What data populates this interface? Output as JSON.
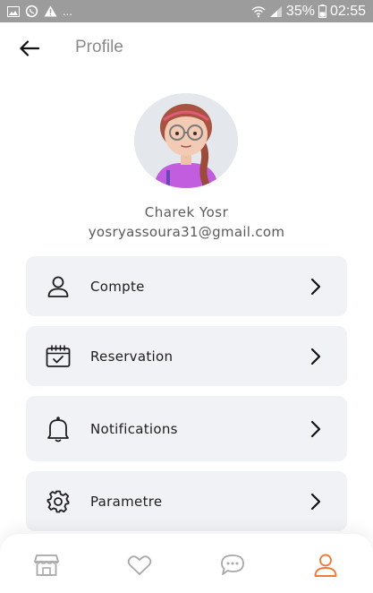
{
  "status_bar": {
    "more": "...",
    "battery": "35%",
    "time": "02:55"
  },
  "header": {
    "title": "Profile",
    "back_icon": "arrow-left-icon"
  },
  "user": {
    "name": "Charek Yosr",
    "email": "yosryassoura31@gmail.com"
  },
  "menu": [
    {
      "label": "Compte",
      "icon": "user-icon"
    },
    {
      "label": "Reservation",
      "icon": "calendar-check-icon"
    },
    {
      "label": "Notifications",
      "icon": "bell-icon"
    },
    {
      "label": "Parametre",
      "icon": "gear-icon"
    }
  ],
  "bottom_nav": {
    "items": [
      "store-icon",
      "heart-icon",
      "chat-icon",
      "user-icon"
    ],
    "active_index": 3
  },
  "colors": {
    "accent": "#f07a3a",
    "card_bg": "#f1f2f5",
    "nav_inactive": "#a8a8a8"
  }
}
